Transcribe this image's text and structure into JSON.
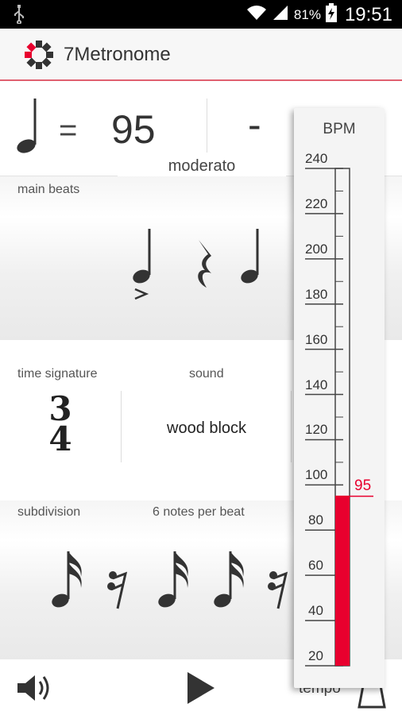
{
  "status_bar": {
    "battery_percent": "81%",
    "time": "19:51"
  },
  "app": {
    "title": "7Metronome"
  },
  "tempo": {
    "value": "95",
    "equals": "=",
    "minus": "-",
    "marking": "moderato"
  },
  "main_beats": {
    "label": "main beats"
  },
  "time_signature": {
    "label": "time signature",
    "numerator": "3",
    "denominator": "4"
  },
  "sound": {
    "label": "sound",
    "value": "wood block"
  },
  "subdivision": {
    "label": "subdivision",
    "description": "6 notes per beat"
  },
  "bottom_bar": {
    "tempo_label": "tempo"
  },
  "bpm_scale": {
    "title": "BPM",
    "min": 20,
    "max": 240,
    "ticks": [
      "240",
      "220",
      "200",
      "180",
      "160",
      "140",
      "120",
      "100",
      "80",
      "60",
      "40",
      "20"
    ],
    "current": 95,
    "current_label": "95",
    "fill_color": "#e8002e"
  },
  "colors": {
    "accent": "#e8002e",
    "divider": "#e06070"
  }
}
